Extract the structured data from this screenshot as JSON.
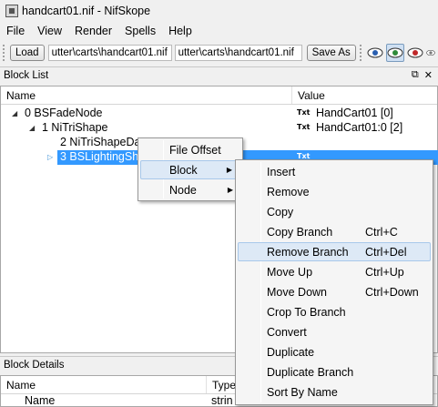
{
  "window": {
    "title": "handcart01.nif - NifSkope"
  },
  "menubar": {
    "items": [
      "File",
      "View",
      "Render",
      "Spells",
      "Help"
    ]
  },
  "toolbar": {
    "load_label": "Load",
    "load_path": "utter\\carts\\handcart01.nif",
    "save_path": "utter\\carts\\handcart01.nif",
    "save_as_label": "Save As"
  },
  "block_list": {
    "title": "Block List",
    "columns": {
      "name": "Name",
      "value": "Value"
    },
    "rows": [
      {
        "label": "0 BSFadeNode",
        "txt": "Txt",
        "value": "HandCart01 [0]"
      },
      {
        "label": "1 NiTriShape",
        "txt": "Txt",
        "value": "HandCart01:0 [2]"
      },
      {
        "label": "2 NiTriShapeDa",
        "txt": "",
        "value": ""
      },
      {
        "label": "3 BSLightingSha",
        "txt": "Txt",
        "value": ""
      }
    ]
  },
  "block_details": {
    "title": "Block Details",
    "columns": {
      "name": "Name",
      "type": "Type"
    },
    "first_row": {
      "name": "Name",
      "type": "strin"
    }
  },
  "context_menu": {
    "items": [
      "File Offset",
      "Block",
      "Node"
    ]
  },
  "block_submenu": {
    "items": [
      {
        "label": "Insert",
        "shortcut": ""
      },
      {
        "label": "Remove",
        "shortcut": ""
      },
      {
        "label": "Copy",
        "shortcut": ""
      },
      {
        "label": "Copy Branch",
        "shortcut": "Ctrl+C"
      },
      {
        "label": "Remove Branch",
        "shortcut": "Ctrl+Del"
      },
      {
        "label": "Move Up",
        "shortcut": "Ctrl+Up"
      },
      {
        "label": "Move Down",
        "shortcut": "Ctrl+Down"
      },
      {
        "label": "Crop To Branch",
        "shortcut": ""
      },
      {
        "label": "Convert",
        "shortcut": ""
      },
      {
        "label": "Duplicate",
        "shortcut": ""
      },
      {
        "label": "Duplicate Branch",
        "shortcut": ""
      },
      {
        "label": "Sort By Name",
        "shortcut": ""
      }
    ]
  }
}
